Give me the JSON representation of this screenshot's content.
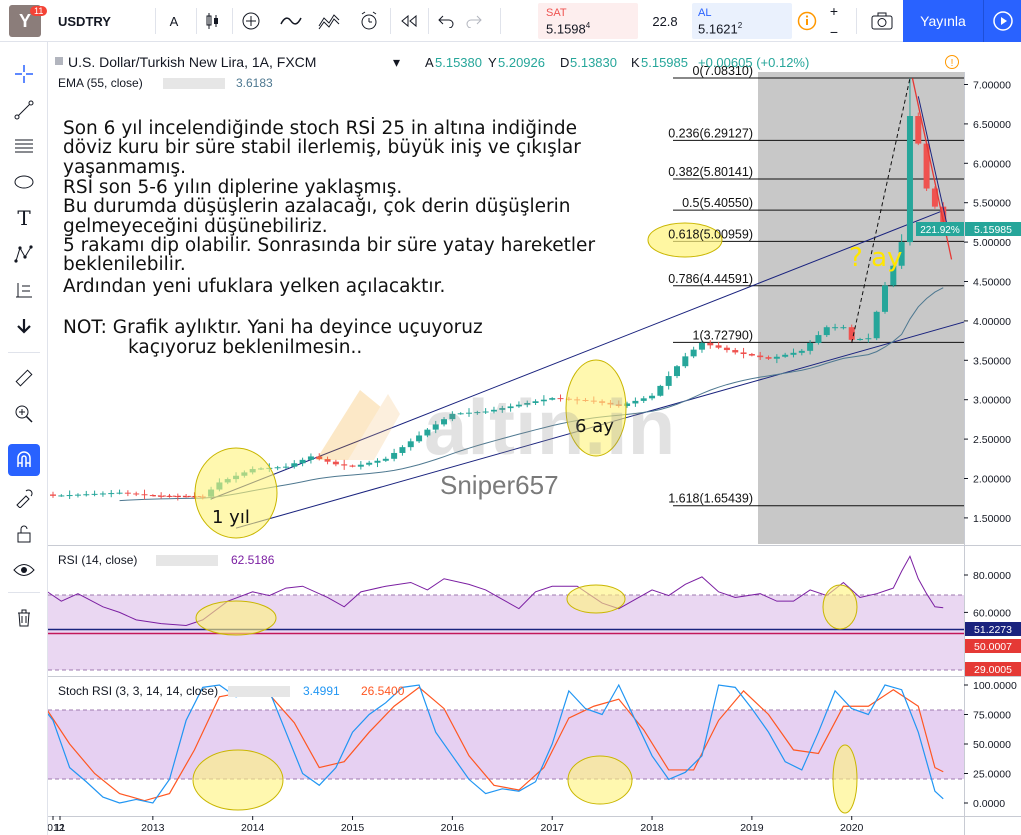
{
  "app": {
    "badge_count": "11",
    "logo_letter": "Y"
  },
  "toolbar": {
    "symbol": "USDTRY",
    "compare_label": "A",
    "sell_label": "SAT",
    "sell_price": "5.1598",
    "sell_sup": "4",
    "spread": "22.8",
    "buy_label": "AL",
    "buy_price": "5.1621",
    "buy_sup": "2",
    "publish_label": "Yayınla"
  },
  "legend": {
    "title": "U.S. Dollar/Turkish New Lira, 1A, FXCM",
    "o_label": "A",
    "o": "5.15380",
    "h_label": "Y",
    "h": "5.20926",
    "l_label": "D",
    "l": "5.13830",
    "c_label": "K",
    "c": "5.15985",
    "change": "+0.00605 (+0.12%)"
  },
  "ema": {
    "label": "EMA (55, close)",
    "value": "3.6183"
  },
  "rsi": {
    "label": "RSI (14, close)",
    "value": "62.5186",
    "tag1": "51.2273",
    "tag2": "50.0007",
    "tag3": "29.0005"
  },
  "stoch": {
    "label": "Stoch RSI (3, 3, 14, 14, close)",
    "k": "3.4991",
    "d": "26.5400"
  },
  "price_axis": {
    "ticks": [
      "7.00000",
      "6.50000",
      "6.00000",
      "5.50000",
      "5.00000",
      "4.50000",
      "4.00000",
      "3.50000",
      "3.00000",
      "2.50000",
      "2.00000",
      "1.50000"
    ],
    "last_percent": "221.92%",
    "last_price": "5.15985"
  },
  "rsi_axis": {
    "ticks": [
      "80.0000",
      "60.0000"
    ]
  },
  "stoch_axis": {
    "ticks": [
      "100.0000",
      "75.0000",
      "50.0000",
      "25.0000",
      "0.0000"
    ]
  },
  "time_axis": {
    "labels": [
      "11",
      "2012",
      "2013",
      "2014",
      "2015",
      "2016",
      "2017",
      "2018",
      "2019",
      "2020"
    ]
  },
  "fib": [
    {
      "label": "0(7.08310)"
    },
    {
      "label": "0.236(6.29127)"
    },
    {
      "label": "0.382(5.80141)"
    },
    {
      "label": "0.5(5.40550)"
    },
    {
      "label": "0.618(5.00959)"
    },
    {
      "label": "0.786(4.44591)"
    },
    {
      "label": "1(3.72790)"
    },
    {
      "label": "1.618(1.65439)"
    }
  ],
  "annotation": {
    "lines": [
      "Son 6 yıl incelendiğinde stoch RSİ 25 in altına indiğinde",
      "döviz kuru bir süre stabil ilerlemiş, büyük iniş ve çıkışlar",
      "yaşanmamış.",
      "RSİ son 5-6 yılın diplerine yaklaşmış.",
      "Bu durumda düşüşlerin azalacağı, çok derin düşüşlerin",
      "gelmeyeceğini düşünebiliriz.",
      "5 rakamı dip olabilir. Sonrasında bir süre yatay hareketler",
      "beklenilebilir.",
      "Ardından yeni ufuklara yelken açılacaktır."
    ],
    "note1": "NOT: Grafik aylıktır. Yani ha deyince uçuyoruz",
    "note2": "kaçıyoruz beklenilmesin..",
    "label_1yil": "1 yıl",
    "label_6ay": "6 ay",
    "label_qay": "? ay",
    "author": "Sniper657",
    "watermark": "altin.in"
  },
  "colors": {
    "accent": "#2962ff",
    "up": "#26a69a",
    "down": "#ef5350",
    "rsi": "#7b1fa2",
    "stoch_k": "#2196f3",
    "stoch_d": "#ff5722"
  }
}
